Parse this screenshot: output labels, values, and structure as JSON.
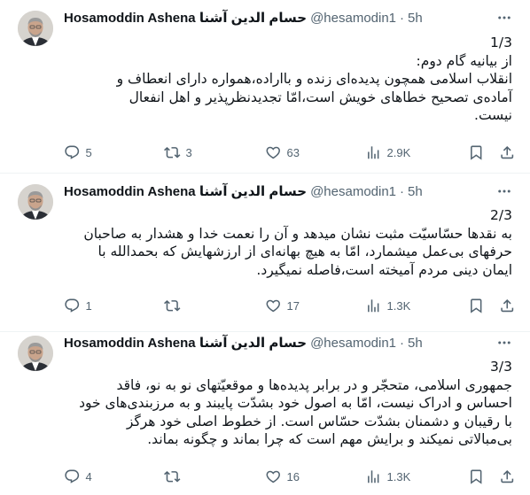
{
  "tweets": [
    {
      "name": "Hosamoddin Ashena حسام الدین آشنا",
      "handle": "@hesamodin1",
      "separator": "·",
      "time": "5h",
      "lines": [
        "1/3",
        "از بیانیه گام دوم:",
        "انقلاب اسلامی همچون پدیده‌ای زنده و بااراده،همواره دارای انعطاف و",
        "آماده‌ی تصحیح خطاهای خویش است،امّا تجدیدنظرپذیر و اهل انفعال",
        "نیست."
      ],
      "replies": "5",
      "retweets": "3",
      "likes": "63",
      "views": "2.9K"
    },
    {
      "name": "Hosamoddin Ashena حسام الدین آشنا",
      "handle": "@hesamodin1",
      "separator": "·",
      "time": "5h",
      "lines": [
        "2/3",
        "به نقدها حسّاسیّت مثبت نشان میدهد و آن را نعمت خدا و هشدار به صاحبان",
        "حرفهای بی‌عمل میشمارد، امّا به هیچ بهانه‌ای از ارزشهایش که بحمدالله با",
        "ایمان دینی مردم آمیخته است،فاصله نمیگیرد."
      ],
      "replies": "1",
      "retweets": "",
      "likes": "17",
      "views": "1.3K"
    },
    {
      "name": "Hosamoddin Ashena حسام الدین آشنا",
      "handle": "@hesamodin1",
      "separator": "·",
      "time": "5h",
      "lines": [
        "3/3",
        "جمهوری اسلامی، متحجّر و در برابر پدیده‌ها و موقعیّتهای نو به نو، فاقد",
        "احساس و ادراک نیست، امّا به اصول خود بشدّت پایبند و به مرزبندی‌های خود",
        "با رقیبان و دشمنان بشدّت حسّاس است. از خطوط اصلی خود هرگز",
        "بی‌مبالاتی نمیکند و برایش مهم است که چرا بماند و چگونه بماند."
      ],
      "replies": "4",
      "retweets": "",
      "likes": "16",
      "views": "1.3K"
    }
  ],
  "icons": {
    "more": "more-dots-icon",
    "reply": "reply-icon",
    "retweet": "retweet-icon",
    "like": "heart-icon",
    "views": "views-chart-icon",
    "bookmark": "bookmark-icon",
    "share": "share-icon"
  },
  "colors": {
    "text": "#0f1419",
    "secondary": "#536471",
    "divider": "#eff3f4"
  }
}
